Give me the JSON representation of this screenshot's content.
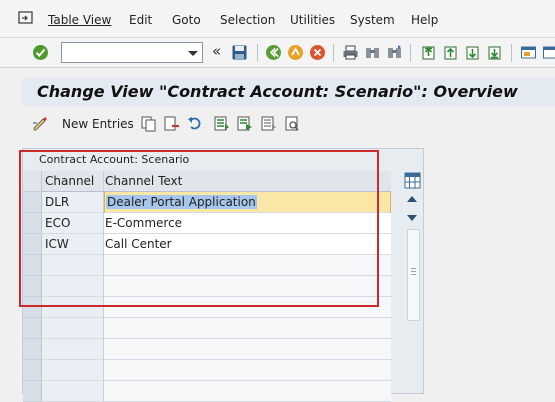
{
  "menu": {
    "icon": "menu-icon",
    "items": [
      {
        "label": "Table View",
        "id": "menu-table-view"
      },
      {
        "label": "Edit",
        "id": "menu-edit"
      },
      {
        "label": "Goto",
        "id": "menu-goto"
      },
      {
        "label": "Selection",
        "id": "menu-selection"
      },
      {
        "label": "Utilities",
        "id": "menu-utilities"
      },
      {
        "label": "System",
        "id": "menu-system"
      },
      {
        "label": "Help",
        "id": "menu-help"
      }
    ]
  },
  "toolbar": {
    "command_value": "",
    "icons": [
      "enter-check-icon",
      "save-icon",
      "back-icon",
      "exit-icon",
      "cancel-icon",
      "print-icon",
      "find-icon",
      "find-next-icon",
      "first-page-icon",
      "previous-page-icon",
      "next-page-icon",
      "last-page-icon",
      "create-session-icon",
      "shortcut-icon"
    ]
  },
  "title": "Change View \"Contract Account: Scenario\": Overview",
  "app_toolbar": {
    "new_entries_label": "New Entries",
    "icons": [
      "edit-pencil-icon",
      "copy-icon",
      "delete-icon",
      "undo-icon",
      "select-all-icon",
      "select-block-icon",
      "deselect-all-icon",
      "where-used-icon"
    ]
  },
  "table": {
    "title": "Contract Account: Scenario",
    "columns": [
      "Channel",
      "Channel Text"
    ],
    "rows": [
      [
        "DLR",
        "Dealer Portal Application"
      ],
      [
        "ECO",
        "E-Commerce"
      ],
      [
        "ICW",
        "Call Center"
      ]
    ],
    "empty_rows": 7
  },
  "colors": {
    "accent_blue": "#e3eaf2",
    "selected_row": "#fbe7a5",
    "highlight_box": "#cc2a2a"
  }
}
